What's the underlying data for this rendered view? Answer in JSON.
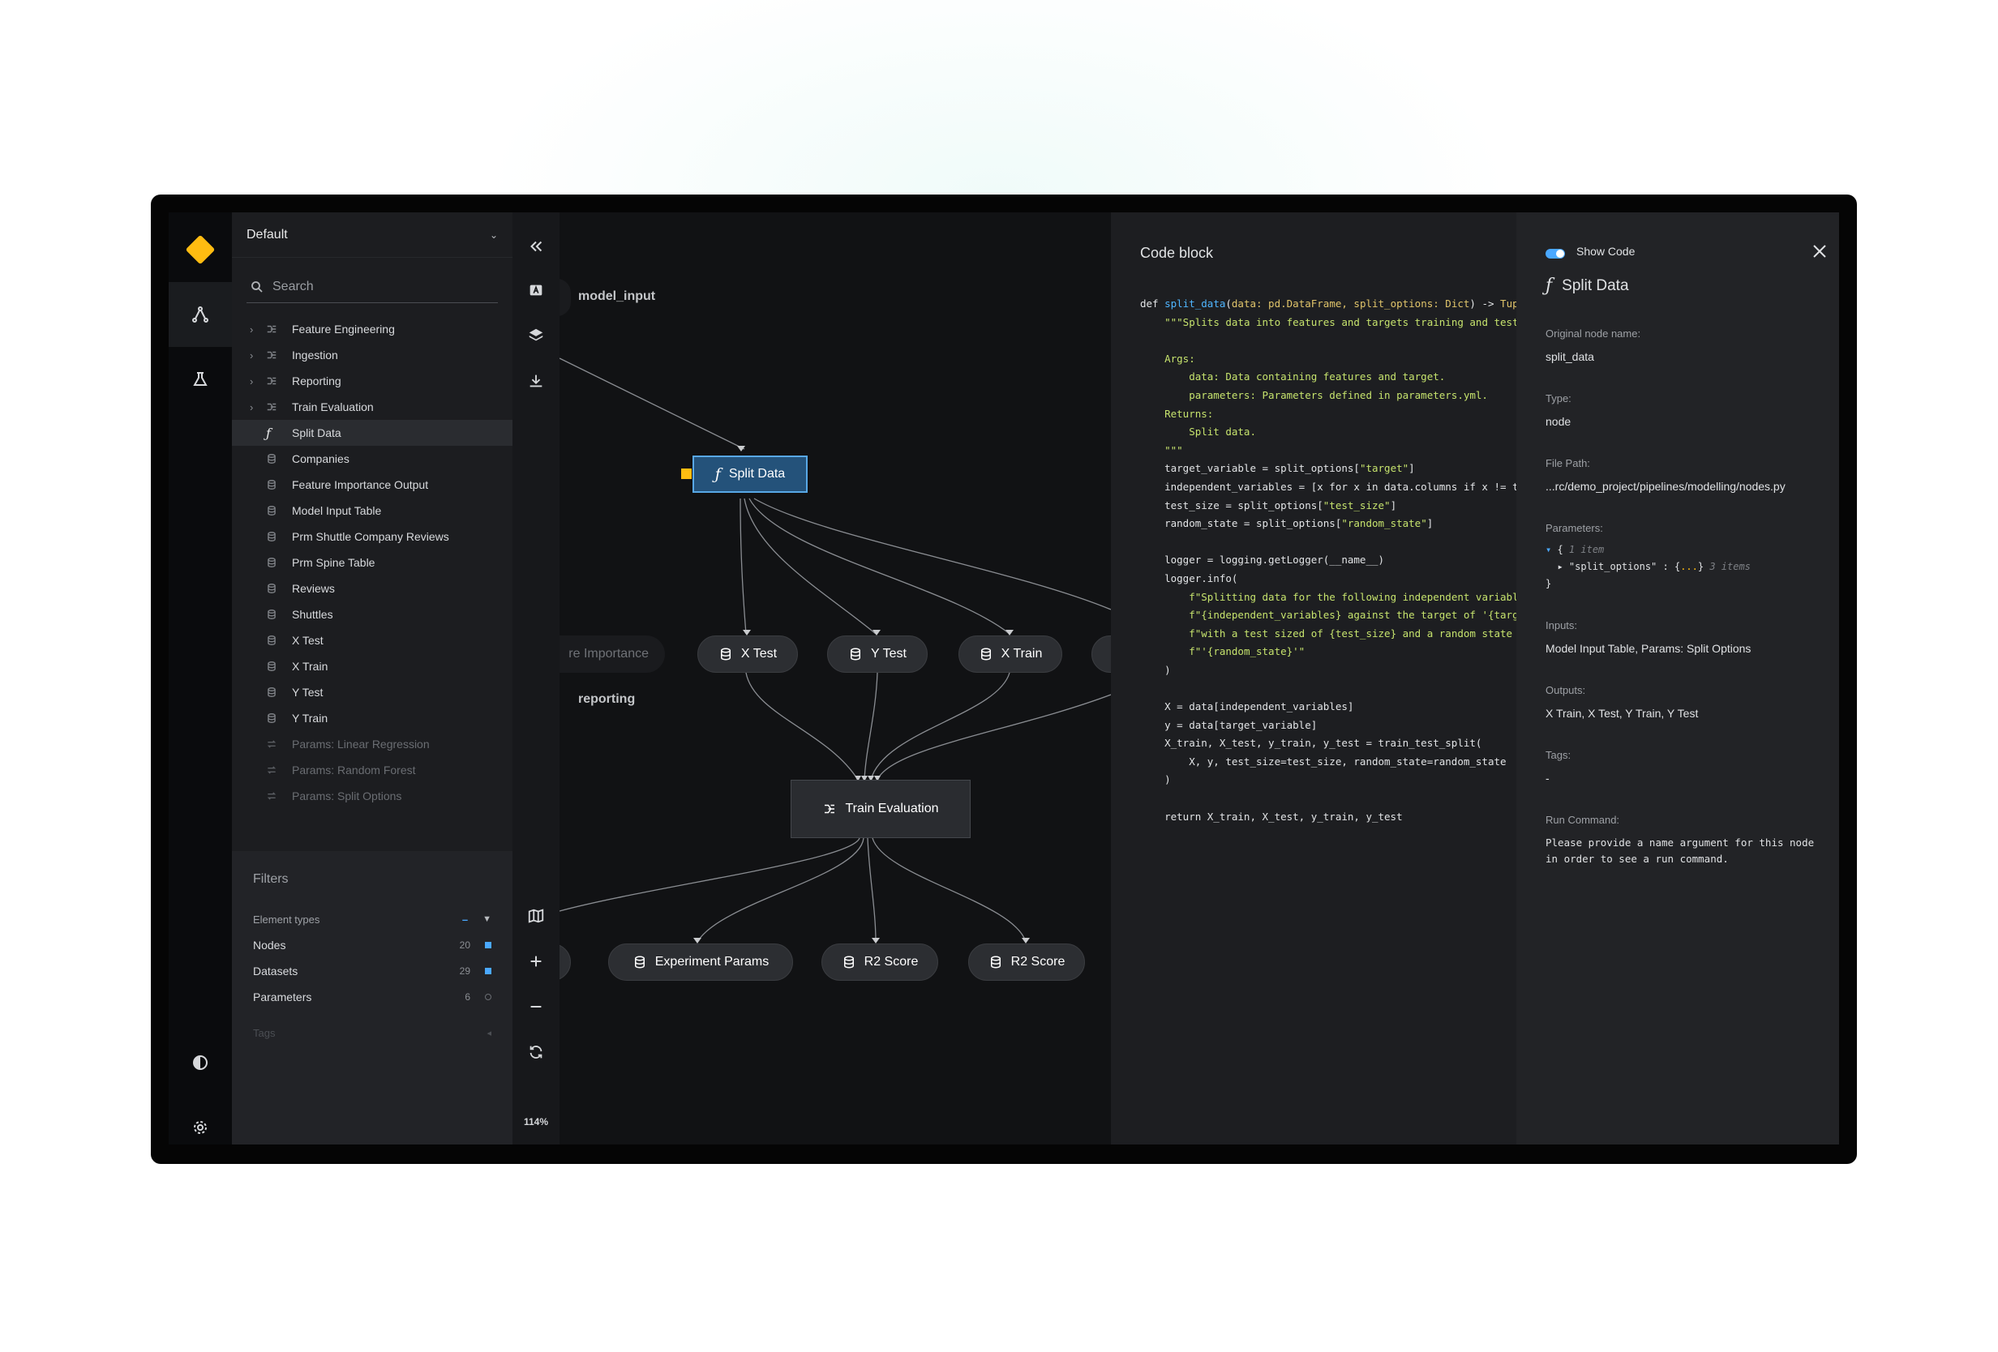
{
  "sidebar": {
    "pipeline": "Default",
    "search_placeholder": "Search",
    "tree": [
      {
        "label": "Feature Engineering",
        "kind": "pipeline",
        "expandable": true
      },
      {
        "label": "Ingestion",
        "kind": "pipeline",
        "expandable": true
      },
      {
        "label": "Reporting",
        "kind": "pipeline",
        "expandable": true
      },
      {
        "label": "Train Evaluation",
        "kind": "pipeline",
        "expandable": true
      },
      {
        "label": "Split Data",
        "kind": "function",
        "selected": true
      },
      {
        "label": "Companies",
        "kind": "dataset"
      },
      {
        "label": "Feature Importance Output",
        "kind": "dataset"
      },
      {
        "label": "Model Input Table",
        "kind": "dataset"
      },
      {
        "label": "Prm Shuttle Company Reviews",
        "kind": "dataset"
      },
      {
        "label": "Prm Spine Table",
        "kind": "dataset"
      },
      {
        "label": "Reviews",
        "kind": "dataset"
      },
      {
        "label": "Shuttles",
        "kind": "dataset"
      },
      {
        "label": "X Test",
        "kind": "dataset"
      },
      {
        "label": "X Train",
        "kind": "dataset"
      },
      {
        "label": "Y Test",
        "kind": "dataset"
      },
      {
        "label": "Y Train",
        "kind": "dataset"
      },
      {
        "label": "Params: Linear Regression",
        "kind": "param",
        "muted": true
      },
      {
        "label": "Params: Random Forest",
        "kind": "param",
        "muted": true
      },
      {
        "label": "Params: Split Options",
        "kind": "param",
        "muted": true
      }
    ],
    "filters": {
      "title": "Filters",
      "group_label": "Element types",
      "rows": [
        {
          "name": "Nodes",
          "count": "20",
          "checked": true
        },
        {
          "name": "Datasets",
          "count": "29",
          "checked": true
        },
        {
          "name": "Parameters",
          "count": "6",
          "checked": false
        }
      ],
      "tags_label": "Tags"
    }
  },
  "toolbar": {
    "zoom": "114%"
  },
  "canvas": {
    "labels": {
      "model_input": "model_input",
      "reporting": "reporting"
    },
    "nodes": {
      "split_data": "Split Data",
      "feature_importance": "re Importance",
      "x_test": "X Test",
      "y_test": "Y Test",
      "x_train": "X Train",
      "train_evaluation": "Train Evaluation",
      "experiment_params": "Experiment Params",
      "r2_score_1": "R2 Score",
      "r2_score_2": "R2 Score"
    }
  },
  "code_panel": {
    "title": "Code block"
  },
  "details": {
    "show_code": "Show Code",
    "node_title": "Split Data",
    "original_name_label": "Original node name:",
    "original_name": "split_data",
    "type_label": "Type:",
    "type": "node",
    "file_path_label": "File Path:",
    "file_path": "...rc/demo_project/pipelines/modelling/nodes.py",
    "parameters_label": "Parameters:",
    "params_count": "1 item",
    "param_key": "\"split_options\"",
    "param_items": "3 items",
    "inputs_label": "Inputs:",
    "inputs": "Model Input Table,   Params: Split Options",
    "outputs_label": "Outputs:",
    "outputs": "X Train,   X Test,   Y Train,   Y Test",
    "tags_label": "Tags:",
    "tags": "-",
    "run_command_label": "Run Command:",
    "run_command": "Please provide a name argument for this node in order to see a run command."
  },
  "colors": {
    "accent_yellow": "#ffbc11",
    "accent_blue": "#4aa8ff",
    "selected_node": "#24527a"
  }
}
